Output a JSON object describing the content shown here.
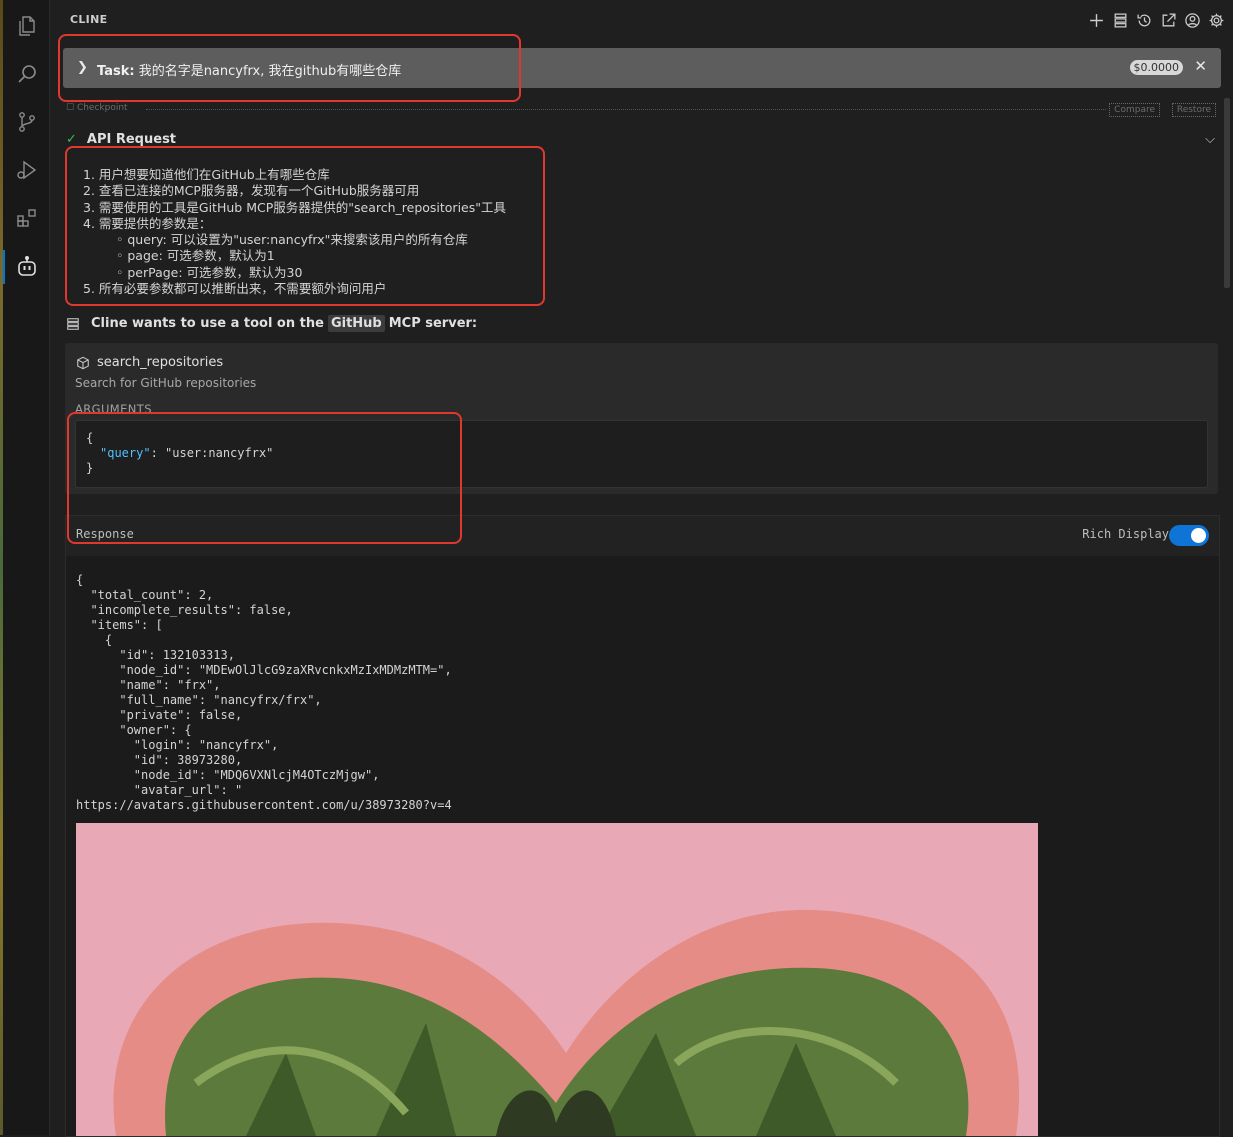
{
  "header": {
    "title": "CLINE"
  },
  "activity_bar": {
    "icons": [
      "explorer-icon",
      "search-icon",
      "source-control-icon",
      "run-debug-icon",
      "extensions-icon",
      "cline-icon"
    ]
  },
  "header_icons": [
    "plus-icon",
    "mcp-servers-icon",
    "history-icon",
    "popout-icon",
    "account-icon",
    "settings-icon"
  ],
  "task": {
    "label": "Task:",
    "text": "我的名字是nancyfrx, 我在github有哪些仓库",
    "cost": "$0.0000"
  },
  "checkpoint": {
    "label": "Checkpoint",
    "compare": "Compare",
    "restore": "Restore"
  },
  "api_request": {
    "title": "API Request"
  },
  "reasoning": [
    "1. 用户想要知道他们在GitHub上有哪些仓库",
    "2. 查看已连接的MCP服务器，发现有一个GitHub服务器可用",
    "3. 需要使用的工具是GitHub MCP服务器提供的\"search_repositories\"工具",
    "4. 需要提供的参数是：",
    "◦ query: 可以设置为\"user:nancyfrx\"来搜索该用户的所有仓库",
    "◦ page: 可选参数，默认为1",
    "◦ perPage: 可选参数，默认为30",
    "5. 所有必要参数都可以推断出来，不需要额外询问用户"
  ],
  "tool_use": {
    "prefix": "Cline wants to use a tool on the",
    "server": "GitHub",
    "suffix": "MCP server:"
  },
  "tool": {
    "name": "search_repositories",
    "description": "Search for GitHub repositories",
    "args_label": "ARGUMENTS",
    "args_open": "{",
    "args_key": "\"query\"",
    "args_value": ": \"user:nancyfrx\"",
    "args_close": "}"
  },
  "response": {
    "label": "Response",
    "rich_display": "Rich Display",
    "rich_display_on": true,
    "json_text": "{\n  \"total_count\": 2,\n  \"incomplete_results\": false,\n  \"items\": [\n    {\n      \"id\": 132103313,\n      \"node_id\": \"MDEwOlJlcG9zaXRvcnkxMzIxMDMzMTM=\",\n      \"name\": \"frx\",\n      \"full_name\": \"nancyfrx/frx\",\n      \"private\": false,\n      \"owner\": {\n        \"login\": \"nancyfrx\",\n        \"id\": 38973280,\n        \"node_id\": \"MDQ6VXNlcjM4OTczMjgw\",\n        \"avatar_url\": \"\nhttps://avatars.githubusercontent.com/u/38973280?v=4"
  },
  "colors": {
    "accent": "#0e75d6",
    "annotation": "#e0382e",
    "check": "#3fb950"
  }
}
